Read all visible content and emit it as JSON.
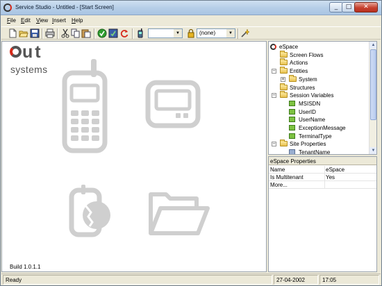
{
  "window": {
    "title": "Service Studio - Untitled - [Start Screen]",
    "controls": {
      "minimize": "_",
      "maximize": "□",
      "close": "✕"
    }
  },
  "menu": [
    "File",
    "Edit",
    "View",
    "Insert",
    "Help"
  ],
  "toolbar": {
    "buttons": [
      "new-icon",
      "open-icon",
      "save-icon",
      "print-icon",
      "cut-icon",
      "copy-icon",
      "paste-icon",
      "verify-icon",
      "publish-icon",
      "refresh-icon",
      "device-icon",
      "lock-icon",
      "wand-icon"
    ],
    "device_combo_value": "",
    "language_combo_value": "(none)"
  },
  "logo": {
    "word1": "ut",
    "word2": "systems"
  },
  "start_screen": {
    "icons": [
      "mobile-phone-icon",
      "pager-icon",
      "pocket-pc-icon",
      "open-folder-icon"
    ],
    "build": "Build 1.0.1.1"
  },
  "tree": {
    "root": "eSpace",
    "items": [
      {
        "label": "Screen Flows",
        "type": "folder",
        "level": 1
      },
      {
        "label": "Actions",
        "type": "folder",
        "level": 1
      },
      {
        "label": "Entities",
        "type": "folder",
        "level": 1,
        "expander": "−"
      },
      {
        "label": "System",
        "type": "folder",
        "level": 2,
        "expander": "+"
      },
      {
        "label": "Structures",
        "type": "folder",
        "level": 1
      },
      {
        "label": "Session Variables",
        "type": "folder",
        "level": 1,
        "expander": "−"
      },
      {
        "label": "MSISDN",
        "type": "var",
        "level": 2
      },
      {
        "label": "UserID",
        "type": "var",
        "level": 2
      },
      {
        "label": "UserName",
        "type": "var",
        "level": 2
      },
      {
        "label": "ExceptionMessage",
        "type": "var",
        "level": 2
      },
      {
        "label": "TerminalType",
        "type": "var",
        "level": 2
      },
      {
        "label": "Site Properties",
        "type": "folder",
        "level": 1,
        "expander": "−"
      },
      {
        "label": "TenantName",
        "type": "site",
        "level": 2
      }
    ]
  },
  "properties": {
    "header": "eSpace Properties",
    "rows": [
      {
        "key": "Name",
        "value": "eSpace"
      },
      {
        "key": "Is Multitenant",
        "value": "Yes"
      },
      {
        "key": "More...",
        "value": ""
      }
    ]
  },
  "status": {
    "text": "Ready",
    "date": "27-04-2002",
    "time": "17:05"
  },
  "colors": {
    "accent": "#d62a1a",
    "logo_gray": "#555555",
    "icon_gray": "#cfcfcf"
  }
}
